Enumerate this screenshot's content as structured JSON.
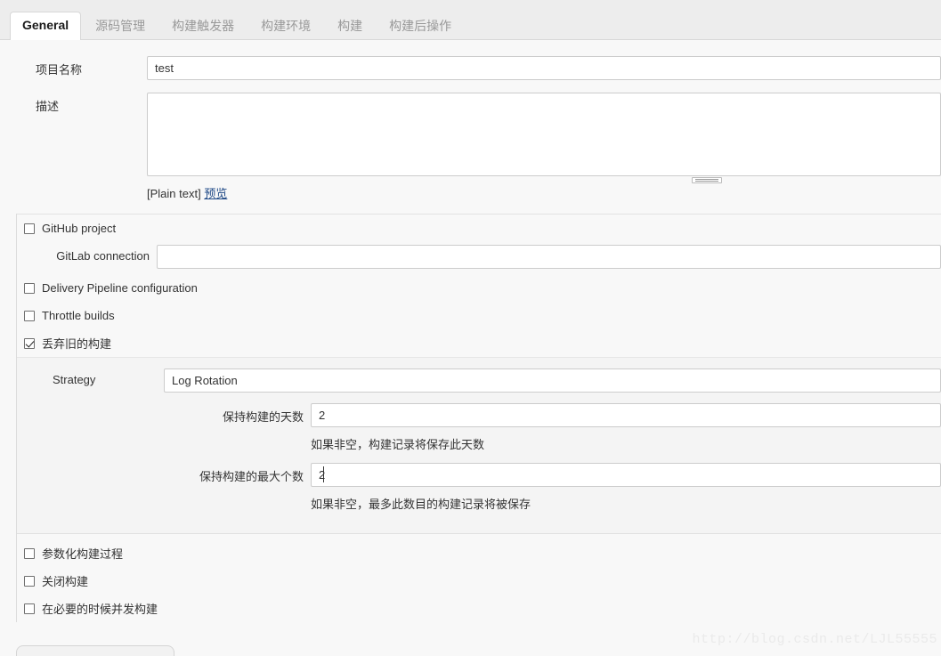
{
  "tabs": [
    {
      "label": "General",
      "active": true
    },
    {
      "label": "源码管理",
      "active": false
    },
    {
      "label": "构建触发器",
      "active": false
    },
    {
      "label": "构建环境",
      "active": false
    },
    {
      "label": "构建",
      "active": false
    },
    {
      "label": "构建后操作",
      "active": false
    }
  ],
  "general": {
    "project_name_label": "项目名称",
    "project_name_value": "test",
    "description_label": "描述",
    "description_value": "",
    "markup_type": "[Plain text]",
    "preview_link": "预览"
  },
  "options": {
    "github_project": "GitHub project",
    "gitlab_connection_label": "GitLab connection",
    "gitlab_connection_value": "",
    "delivery_pipeline": "Delivery Pipeline configuration",
    "throttle_builds": "Throttle builds",
    "discard_old_builds": "丢弃旧的构建",
    "parameterized_build": "参数化构建过程",
    "disable_build": "关闭构建",
    "concurrent_build": "在必要的时候并发构建"
  },
  "strategy": {
    "label": "Strategy",
    "value": "Log Rotation",
    "days_to_keep_label": "保持构建的天数",
    "days_to_keep_value": "2",
    "days_to_keep_help": "如果非空，构建记录将保存此天数",
    "max_builds_label": "保持构建的最大个数",
    "max_builds_value": "2",
    "max_builds_help": "如果非空，最多此数目的构建记录将被保存"
  },
  "watermark": "http://blog.csdn.net/LJL55555",
  "colors": {
    "page_bg": "#f8f8f8",
    "tabbar_bg": "#ededed",
    "active_tab_bg": "#ffffff",
    "link": "#204a87",
    "border": "#cccccc"
  }
}
